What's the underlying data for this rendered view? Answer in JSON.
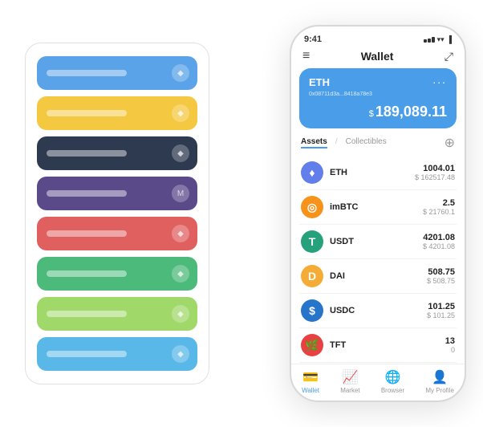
{
  "backPanel": {
    "rows": [
      {
        "color": "row-blue",
        "iconText": "◆"
      },
      {
        "color": "row-yellow",
        "iconText": "◆"
      },
      {
        "color": "row-dark",
        "iconText": "◆"
      },
      {
        "color": "row-purple",
        "iconText": "M"
      },
      {
        "color": "row-red",
        "iconText": "◆"
      },
      {
        "color": "row-green",
        "iconText": "◆"
      },
      {
        "color": "row-lgreen",
        "iconText": "◆"
      },
      {
        "color": "row-lblue",
        "iconText": "◆"
      }
    ]
  },
  "phone": {
    "status": {
      "time": "9:41",
      "signal": "▌▌▌",
      "wifi": "WiFi",
      "battery": "🔋"
    },
    "nav": {
      "menu_icon": "≡",
      "title": "Wallet",
      "expand_icon": "⤢"
    },
    "ethCard": {
      "title": "ETH",
      "address": "0x08711d3a...8418a78e3",
      "address_suffix": "🔗",
      "more": "...",
      "balance_symbol": "$",
      "balance": "189,089.11"
    },
    "assets": {
      "tab_active": "Assets",
      "tab_slash": "/",
      "tab_inactive": "Collectibles",
      "add_icon": "⊕",
      "items": [
        {
          "symbol": "ETH",
          "icon_char": "♦",
          "icon_color": "#627eea",
          "amount": "1004.01",
          "usd": "$ 162517.48"
        },
        {
          "symbol": "imBTC",
          "icon_char": "⊙",
          "icon_color": "#f7931a",
          "amount": "2.5",
          "usd": "$ 21760.1"
        },
        {
          "symbol": "USDT",
          "icon_char": "T",
          "icon_color": "#26a17b",
          "amount": "4201.08",
          "usd": "$ 4201.08"
        },
        {
          "symbol": "DAI",
          "icon_char": "D",
          "icon_color": "#f5ac37",
          "amount": "508.75",
          "usd": "$ 508.75"
        },
        {
          "symbol": "USDC",
          "icon_char": "$",
          "icon_color": "#2775ca",
          "amount": "101.25",
          "usd": "$ 101.25"
        },
        {
          "symbol": "TFT",
          "icon_char": "🌿",
          "icon_color": "#e84142",
          "amount": "13",
          "usd": "0"
        }
      ]
    },
    "bottomNav": [
      {
        "label": "Wallet",
        "icon": "💳",
        "active": true
      },
      {
        "label": "Market",
        "icon": "📊",
        "active": false
      },
      {
        "label": "Browser",
        "icon": "👤",
        "active": false
      },
      {
        "label": "My Profile",
        "icon": "👤",
        "active": false
      }
    ]
  }
}
